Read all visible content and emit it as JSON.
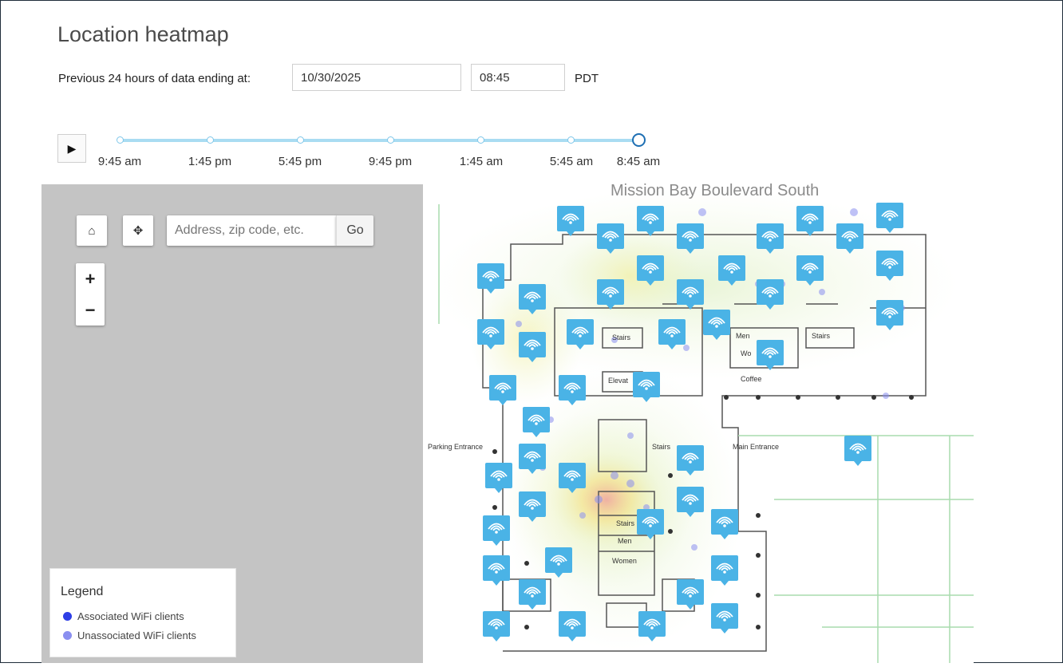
{
  "page": {
    "title": "Location heatmap"
  },
  "controls": {
    "label": "Previous 24 hours of data ending at:",
    "date_value": "10/30/2025",
    "time_value": "08:45",
    "timezone": "PDT"
  },
  "timeline": {
    "play_icon": "play-icon",
    "labels": [
      "9:45 am",
      "1:45 pm",
      "5:45 pm",
      "9:45 pm",
      "1:45 am",
      "5:45 am",
      "8:45 am"
    ]
  },
  "map": {
    "search_placeholder": "Address, zip code, etc.",
    "go_label": "Go",
    "home_icon": "home-icon",
    "locate_icon": "crosshair-icon",
    "zoom_in": "+",
    "zoom_out": "−",
    "street_label": "Mission Bay Boulevard South",
    "room_labels": {
      "stairs_1": "Stairs",
      "men_1": "Men",
      "stairs_2": "Stairs",
      "women_1": "Wo",
      "coffee": "Coffee",
      "elevator": "Elevat",
      "parking": "Parking Entrance",
      "stairs_3": "Stairs",
      "main_entrance": "Main Entrance",
      "stairs_4": "Stairs",
      "men_2": "Men",
      "women_2": "Women"
    }
  },
  "legend": {
    "title": "Legend",
    "items": [
      {
        "label": "Associated WiFi clients",
        "color": "#2e3ee6"
      },
      {
        "label": "Unassociated WiFi clients",
        "color": "#8a8ff0"
      }
    ]
  },
  "colors": {
    "access_point": "#4ab3e6",
    "timeline": "#a9dcf2",
    "timeline_active": "#1e6fb3"
  }
}
